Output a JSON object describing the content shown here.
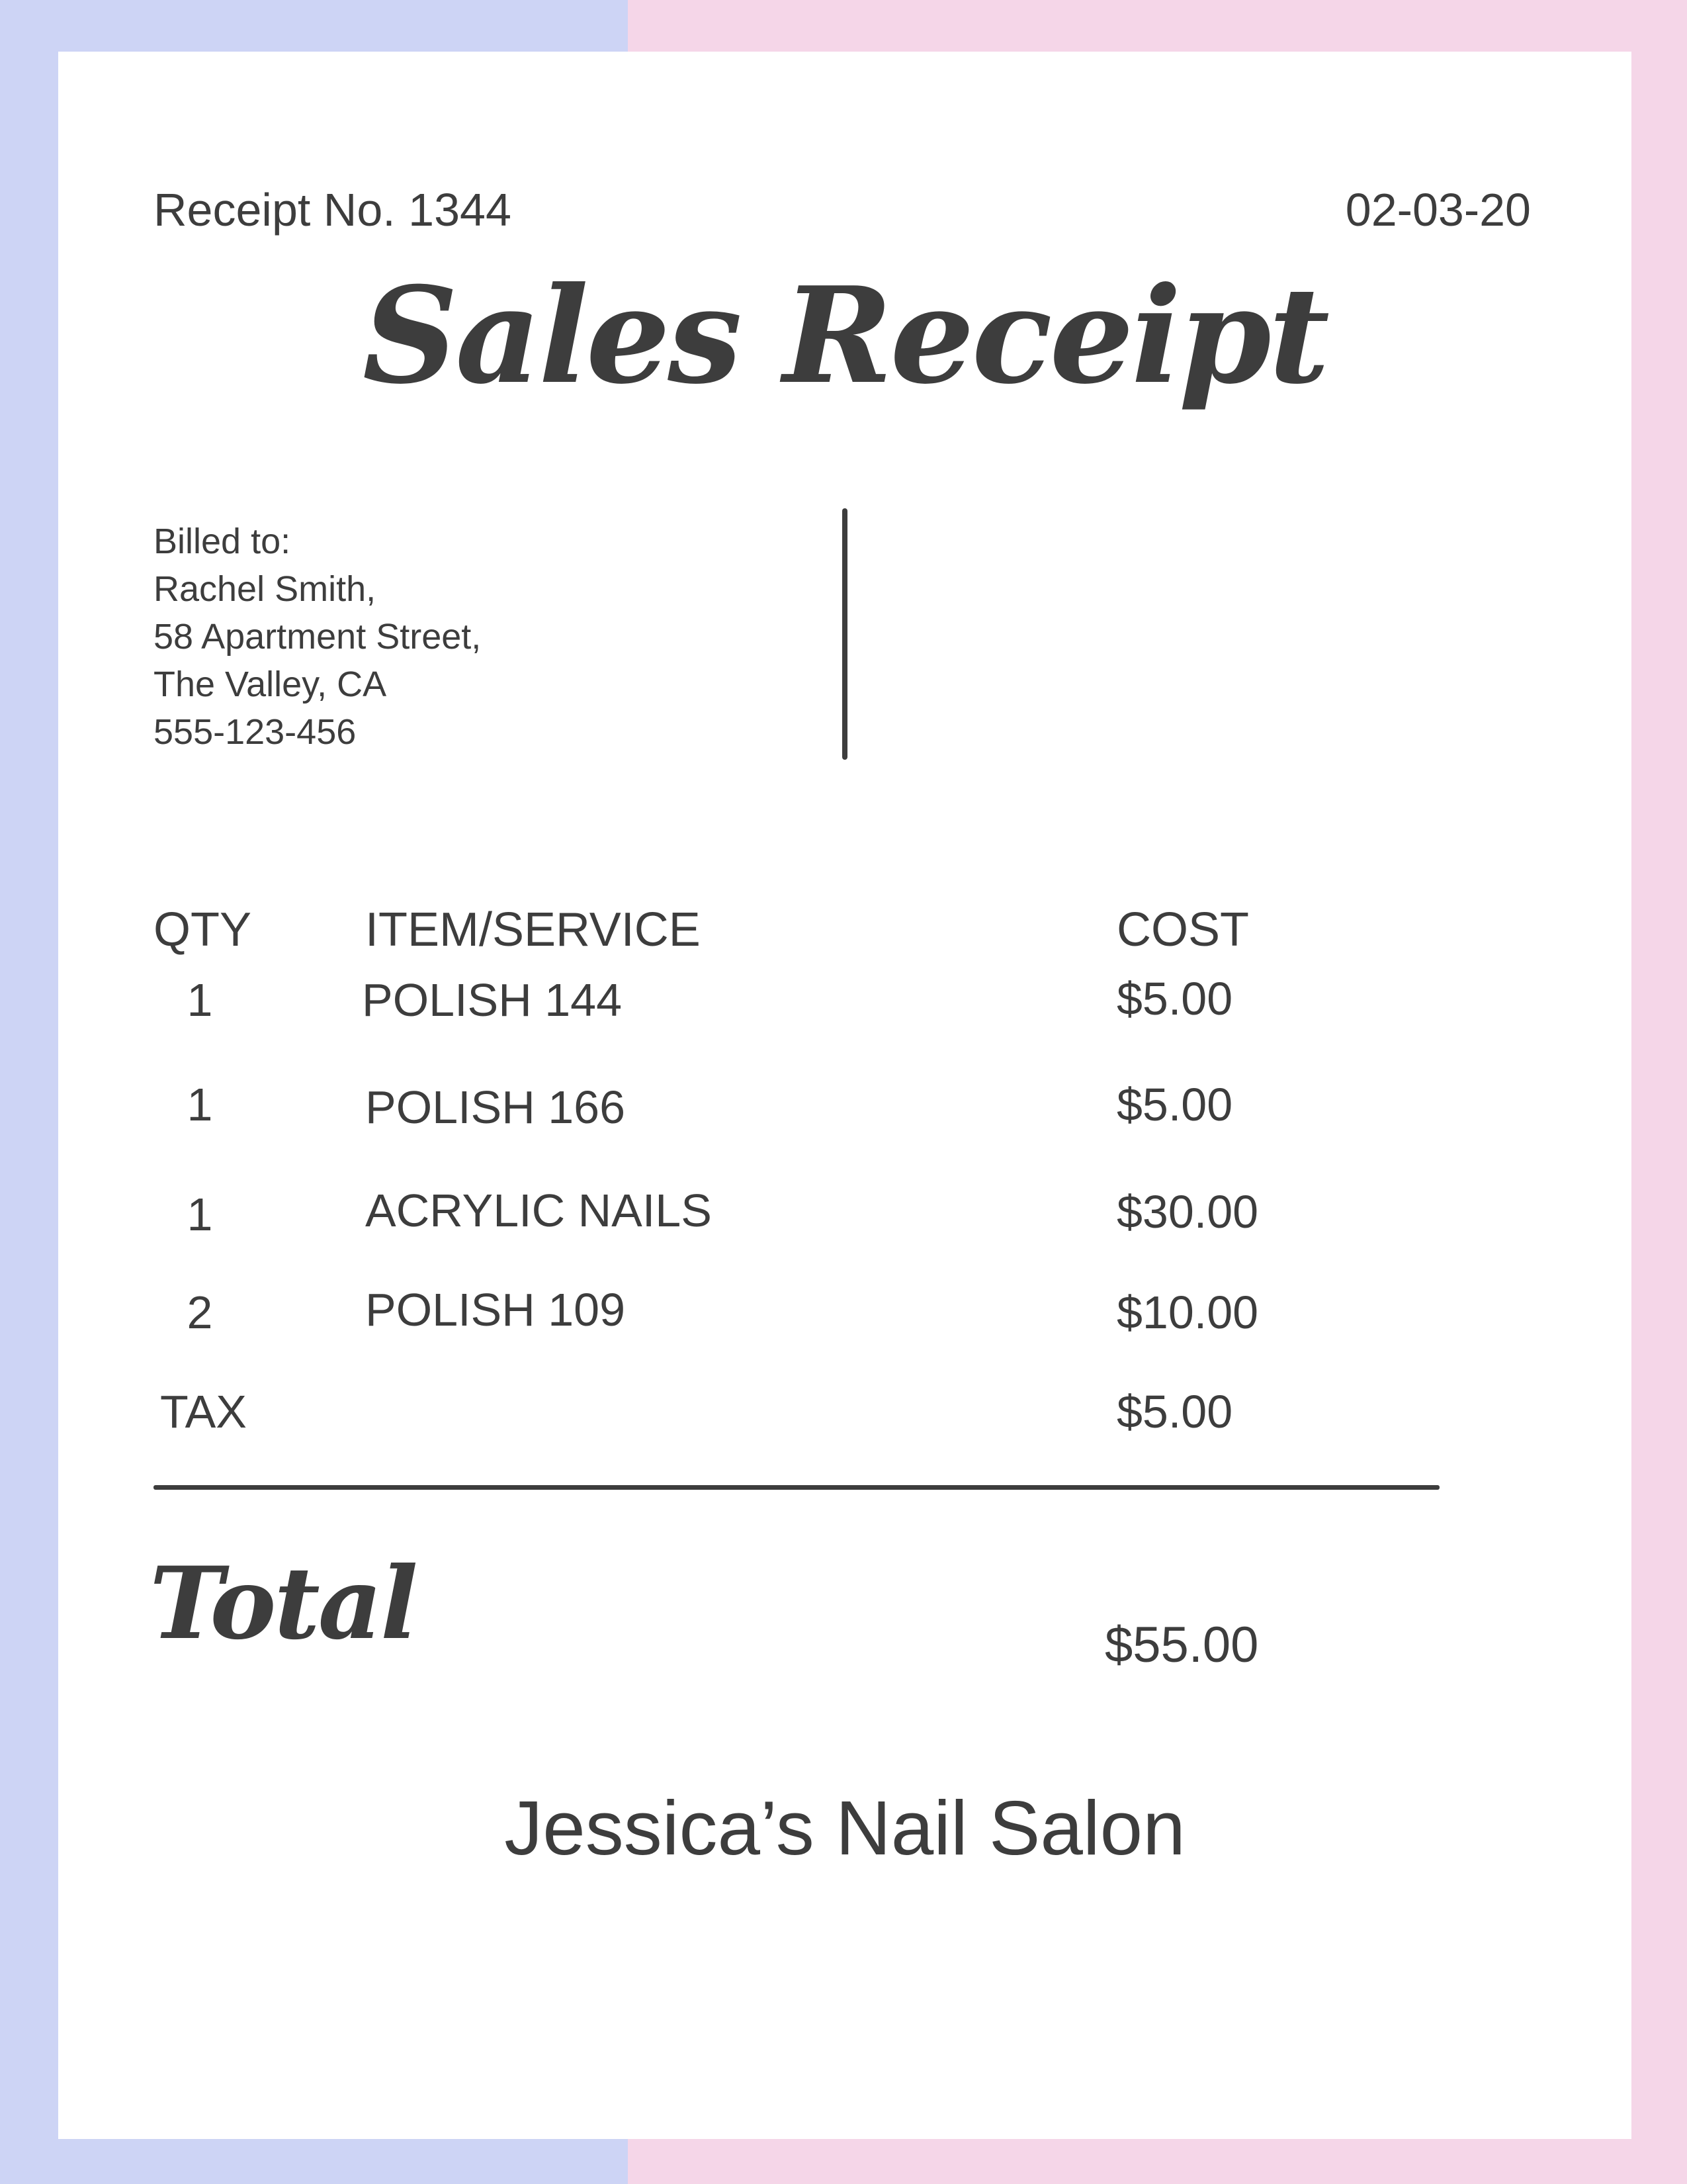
{
  "colors": {
    "left_band": "#cdd4f5",
    "right_band": "#f5d6e8",
    "paper": "#ffffff",
    "ink": "#3d3d3d"
  },
  "header": {
    "receipt_number": "Receipt No. 1344",
    "date": "02-03-20",
    "title": "Sales Receipt"
  },
  "billed_to": {
    "label": "Billed to:",
    "lines": [
      "Rachel Smith,",
      "58 Apartment Street,",
      "The Valley, CA",
      "555-123-456"
    ]
  },
  "table": {
    "headers": {
      "qty": "QTY",
      "item": "ITEM/SERVICE",
      "cost": "COST"
    },
    "rows": [
      {
        "qty": "1",
        "item": "POLISH 144",
        "cost": "$5.00"
      },
      {
        "qty": "1",
        "item": "POLISH 166",
        "cost": "$5.00"
      },
      {
        "qty": "1",
        "item": "ACRYLIC NAILS",
        "cost": "$30.00"
      },
      {
        "qty": "2",
        "item": "POLISH 109",
        "cost": "$10.00"
      }
    ],
    "tax": {
      "label": "TAX",
      "cost": "$5.00"
    }
  },
  "total": {
    "label": "Total",
    "value": "$55.00"
  },
  "footer": {
    "business_name": "Jessica’s Nail Salon"
  }
}
